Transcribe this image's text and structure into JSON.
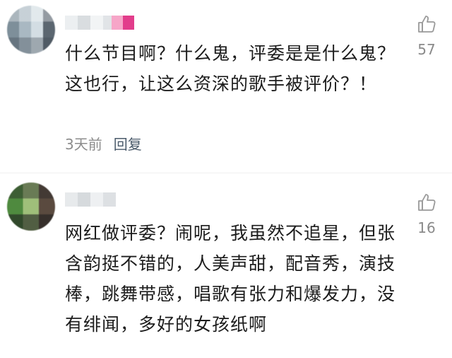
{
  "comments": [
    {
      "text": "什么节目啊？什么鬼，评委是是什么鬼？这也行，让这么资深的歌手被评价？！",
      "time": "3天前",
      "reply_label": "回复",
      "likes": "57"
    },
    {
      "text": "网红做评委？闹呢，我虽然不追星，但张含韵挺不错的，人美声甜，配音秀，演技棒，跳舞带感，唱歌有张力和爆发力，没有绯闻，多好的女孩纸啊",
      "likes": "16"
    }
  ],
  "colors": {
    "text": "#1c1c1c",
    "meta": "#8c8c8c",
    "badge": "#e23d8b"
  }
}
